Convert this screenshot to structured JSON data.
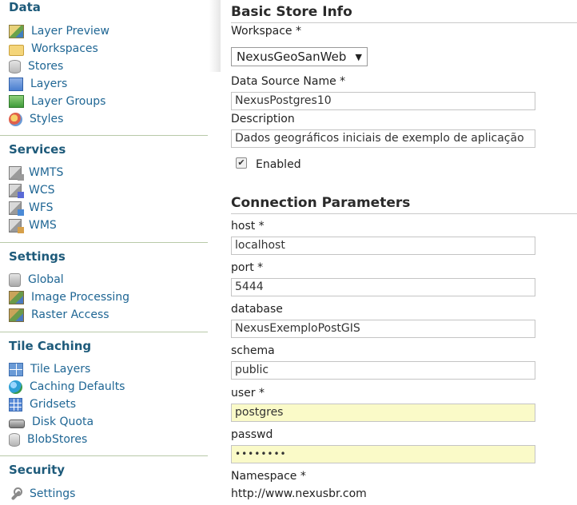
{
  "sidebar": {
    "sections": [
      {
        "title": "Data",
        "items": [
          {
            "label": "Layer Preview",
            "icon": "layer-preview-icon"
          },
          {
            "label": "Workspaces",
            "icon": "folder-icon"
          },
          {
            "label": "Stores",
            "icon": "store-icon"
          },
          {
            "label": "Layers",
            "icon": "layer-icon"
          },
          {
            "label": "Layer Groups",
            "icon": "layer-group-icon"
          },
          {
            "label": "Styles",
            "icon": "style-icon"
          }
        ]
      },
      {
        "title": "Services",
        "items": [
          {
            "label": "WMTS",
            "icon": "wmts-icon"
          },
          {
            "label": "WCS",
            "icon": "wcs-icon"
          },
          {
            "label": "WFS",
            "icon": "wfs-icon"
          },
          {
            "label": "WMS",
            "icon": "wms-icon"
          }
        ]
      },
      {
        "title": "Settings",
        "items": [
          {
            "label": "Global",
            "icon": "global-icon"
          },
          {
            "label": "Image Processing",
            "icon": "image-processing-icon"
          },
          {
            "label": "Raster Access",
            "icon": "raster-access-icon"
          }
        ]
      },
      {
        "title": "Tile Caching",
        "items": [
          {
            "label": "Tile Layers",
            "icon": "tile-layers-icon"
          },
          {
            "label": "Caching Defaults",
            "icon": "globe-icon"
          },
          {
            "label": "Gridsets",
            "icon": "grid-icon"
          },
          {
            "label": "Disk Quota",
            "icon": "disk-icon"
          },
          {
            "label": "BlobStores",
            "icon": "blobstore-icon"
          }
        ]
      },
      {
        "title": "Security",
        "items": [
          {
            "label": "Settings",
            "icon": "wrench-icon"
          }
        ]
      }
    ]
  },
  "basic": {
    "heading": "Basic Store Info",
    "workspace_label": "Workspace *",
    "workspace_value": "NexusGeoSanWeb",
    "datasource_label": "Data Source Name *",
    "datasource_value": "NexusPostgres10",
    "description_label": "Description",
    "description_value": "Dados geográficos iniciais de exemplo de aplicação",
    "enabled_label": "Enabled",
    "enabled_checked": true
  },
  "connection": {
    "heading": "Connection Parameters",
    "host_label": "host *",
    "host_value": "localhost",
    "port_label": "port *",
    "port_value": "5444",
    "database_label": "database",
    "database_value": "NexusExemploPostGIS",
    "schema_label": "schema",
    "schema_value": "public",
    "user_label": "user *",
    "user_value": "postgres",
    "passwd_label": "passwd",
    "passwd_value": "••••••••",
    "namespace_label": "Namespace *",
    "namespace_value": "http://www.nexusbr.com"
  }
}
